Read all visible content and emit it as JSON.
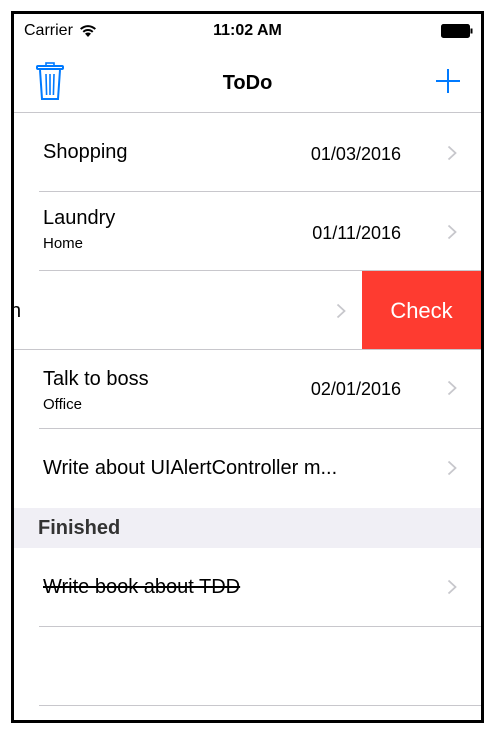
{
  "status_bar": {
    "carrier": "Carrier",
    "time": "11:02 AM"
  },
  "nav": {
    "title": "ToDo",
    "left_icon": "trash-icon",
    "right_icon": "plus-icon",
    "accent_color": "#007aff"
  },
  "items": [
    {
      "title": "Shopping",
      "subtitle": "",
      "date": "01/03/2016"
    },
    {
      "title": "Laundry",
      "subtitle": "Home",
      "date": "01/11/2016"
    },
    {
      "title": "h",
      "subtitle": "",
      "date": "",
      "swiped": true,
      "action_label": "Check",
      "action_color": "#fe3b30"
    },
    {
      "title": "Talk to boss",
      "subtitle": "Office",
      "date": "02/01/2016"
    },
    {
      "title": "Write about UIAlertController m...",
      "subtitle": "",
      "date": ""
    }
  ],
  "finished_section": {
    "header": "Finished",
    "items": [
      {
        "title": "Write book about TDD"
      }
    ]
  }
}
